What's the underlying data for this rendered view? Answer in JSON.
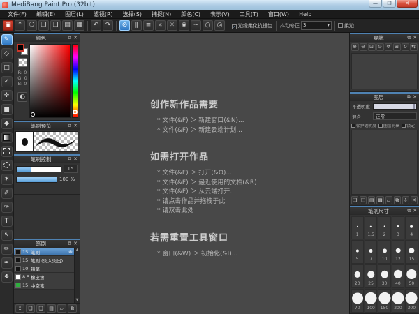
{
  "window": {
    "title": "MediBang Paint Pro (32bit)",
    "minimize": "—",
    "maximize": "❐",
    "close": "✕"
  },
  "menu": [
    "文件(F)",
    "编辑(E)",
    "图层(L)",
    "滤镜(R)",
    "选择(S)",
    "捕捉(N)",
    "颜色(C)",
    "表示(V)",
    "工具(T)",
    "窗口(W)",
    "Help"
  ],
  "toolbar": {
    "file_icons": [
      {
        "name": "save-icon",
        "glyph": "▣",
        "red": true
      },
      {
        "name": "export-icon",
        "glyph": "↑"
      },
      {
        "name": "comment-icon",
        "glyph": "❍"
      },
      {
        "name": "publish-icon",
        "glyph": "❐"
      },
      {
        "name": "document-icon",
        "glyph": "❏"
      },
      {
        "name": "pages-icon",
        "glyph": "▤"
      },
      {
        "name": "tiles-icon",
        "glyph": "▦"
      }
    ],
    "undo": "↶",
    "redo": "↷",
    "snap_icons": [
      {
        "name": "snap-off-icon",
        "glyph": "⊘",
        "selected": true
      },
      {
        "name": "snap-parallel-icon",
        "glyph": "∥"
      },
      {
        "name": "snap-horizontal-icon",
        "glyph": "≡"
      },
      {
        "name": "snap-vanishing-icon",
        "glyph": "«"
      },
      {
        "name": "snap-cross-icon",
        "glyph": "✳"
      },
      {
        "name": "snap-ellipse-icon",
        "glyph": "◉"
      },
      {
        "name": "snap-curve-icon",
        "glyph": "∼"
      },
      {
        "name": "snap-circle-icon",
        "glyph": "○"
      },
      {
        "name": "snap-radial-icon",
        "glyph": "◎"
      }
    ],
    "soften_label": "边缘柔化抗锯齿",
    "stabilizer_label": "抖动修正",
    "stabilizer_value": "3",
    "soft_edge_label": "柔边"
  },
  "tools": [
    {
      "name": "brush-tool",
      "glyph": "✎",
      "selected": true
    },
    {
      "name": "dot-pen-tool",
      "glyph": "◇"
    },
    {
      "name": "marquee-tool",
      "glyph": "□"
    },
    {
      "name": "polyline-select-tool",
      "glyph": "✓"
    },
    {
      "name": "move-tool",
      "glyph": "✛"
    },
    {
      "name": "fill-rect-tool",
      "glyph": "■"
    },
    {
      "name": "bucket-tool",
      "glyph": "◆"
    },
    {
      "name": "gradient-tool",
      "style": "gradient"
    },
    {
      "name": "select-rect-tool",
      "style": "dashed-square"
    },
    {
      "name": "lasso-tool",
      "style": "dashed-circle"
    },
    {
      "name": "magic-wand-tool",
      "glyph": "✶"
    },
    {
      "name": "select-pen-tool",
      "glyph": "✐"
    },
    {
      "name": "select-eraser-tool",
      "glyph": "✑"
    },
    {
      "name": "text-tool",
      "glyph": "T"
    },
    {
      "name": "operation-tool",
      "glyph": "↖"
    },
    {
      "name": "pen-tool",
      "glyph": "✏"
    },
    {
      "name": "eyedropper-tool",
      "glyph": "✒"
    },
    {
      "name": "hand-tool",
      "glyph": "❖"
    }
  ],
  "panel_icons": {
    "popout": "⧉",
    "close": "✕"
  },
  "color_panel": {
    "title": "颜色",
    "r": "R: 0",
    "g": "G: 0",
    "b": "B: 0",
    "palette_icon": "◐"
  },
  "brush_preview_panel": {
    "title": "笔刷预览"
  },
  "brush_control_panel": {
    "title": "笔刷控制",
    "size_value": "15",
    "opacity_value": "100 %"
  },
  "brush_panel": {
    "title": "笔刷",
    "brushes": [
      {
        "size": "15",
        "name": "笔刷",
        "swatch": "#141414",
        "selected": true
      },
      {
        "size": "15",
        "name": "笔刷 (淡入淡出)",
        "swatch": "#141414"
      },
      {
        "size": "10",
        "name": "铅笔",
        "swatch": "#141414"
      },
      {
        "size": "8.5",
        "name": "橡皮擦",
        "swatch": "#ffffff"
      },
      {
        "size": "15",
        "name": "中空笔",
        "swatch": "#2fae3e"
      }
    ],
    "gear_icon": "⊛",
    "buttons": [
      {
        "name": "upload-brush-icon",
        "glyph": "↥"
      },
      {
        "name": "add-brush-icon",
        "glyph": "❏"
      },
      {
        "name": "add-brush-menu-icon",
        "glyph": "❑"
      },
      {
        "name": "brush-script-icon",
        "glyph": "▤"
      },
      {
        "name": "brush-folder-icon",
        "glyph": "▱"
      },
      {
        "name": "duplicate-brush-icon",
        "glyph": "⧉"
      }
    ],
    "scroll_up": "▲",
    "scroll_down": "▼"
  },
  "navigator_panel": {
    "title": "导航",
    "buttons": [
      {
        "name": "zoom-in-icon",
        "glyph": "⊕"
      },
      {
        "name": "zoom-out-icon",
        "glyph": "⊖"
      },
      {
        "name": "fit-view-icon",
        "glyph": "⊡"
      },
      {
        "name": "actual-size-icon",
        "glyph": "⊙"
      },
      {
        "name": "rotate-left-icon",
        "glyph": "↺"
      },
      {
        "name": "reset-rotation-icon",
        "glyph": "⊞"
      },
      {
        "name": "rotate-right-icon",
        "glyph": "↻"
      },
      {
        "name": "flip-icon",
        "glyph": "⇆"
      }
    ]
  },
  "layers_panel": {
    "title": "图层",
    "opacity_label": "不透明度",
    "blend_label": "混合",
    "blend_value": "正常",
    "checks": [
      "保护透明度",
      "图层剪辑",
      "锁定"
    ],
    "buttons": [
      {
        "name": "new-layer-icon",
        "glyph": "❏"
      },
      {
        "name": "new-8bit-layer-icon",
        "glyph": "❑"
      },
      {
        "name": "new-1bit-layer-icon",
        "glyph": "▤"
      },
      {
        "name": "new-halftone-layer-icon",
        "glyph": "▩"
      },
      {
        "name": "layer-folder-icon",
        "glyph": "▱"
      },
      {
        "name": "duplicate-layer-icon",
        "glyph": "⧉"
      },
      {
        "name": "merge-layer-icon",
        "glyph": "⇩"
      },
      {
        "name": "delete-layer-icon",
        "glyph": "✕"
      }
    ]
  },
  "brush_size_panel": {
    "title": "笔刷尺寸",
    "sizes": [
      [
        "1",
        "1.5",
        "2",
        "3",
        "4"
      ],
      [
        "5",
        "7",
        "10",
        "12",
        "15"
      ],
      [
        "20",
        "25",
        "30",
        "40",
        "50"
      ],
      [
        "70",
        "100",
        "150",
        "200",
        "300"
      ]
    ]
  },
  "welcome": {
    "sections": [
      {
        "heading": "创作新作品需要",
        "items": [
          "* 文件(&F) ＞ 新建窗口(&N)...",
          "* 文件(&F) ＞ 新建云端计划..."
        ]
      },
      {
        "heading": "如需打开作品",
        "items": [
          "* 文件(&F) ＞ 打开(&O)...",
          "* 文件(&F) ＞ 最近使用的文档(&R)",
          "* 文件(&F) ＞ 从云端打开...",
          "* 请点击作品并拖拽于此",
          "* 请双击此处"
        ]
      },
      {
        "heading": "若需重置工具窗口",
        "items": [
          "* 窗口(&W) ＞ 初始化(&I)..."
        ]
      }
    ]
  }
}
